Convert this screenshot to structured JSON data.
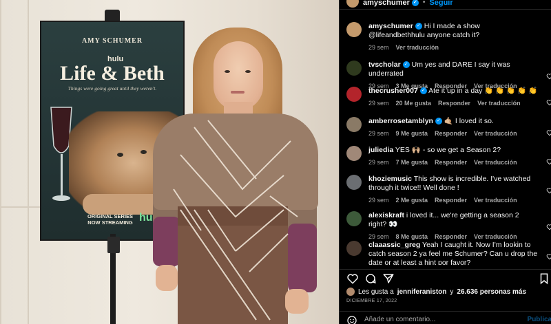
{
  "photo": {
    "poster": {
      "actor_name": "AMY SCHUMER",
      "network": "hulu",
      "title": "Life & Beth",
      "tagline": "Things were going great until they weren't.",
      "original_series": "ORIGINAL SERIES",
      "now_streaming": "NOW STREAMING",
      "brand": "hulu"
    }
  },
  "header": {
    "username": "amyschumer",
    "verified_mark": "✓",
    "separator": "•",
    "follow_label": "Seguir"
  },
  "comments": [
    {
      "user": "amyschumer",
      "verified": true,
      "text": "Hi I made a show @lifeandbethhulu anyone catch it?",
      "time": "29 sem",
      "likes": "",
      "reply": "",
      "translate": "Ver traducción",
      "avatar_color": "#c49a6c",
      "show_heart": false
    },
    {
      "user": "tvscholar",
      "verified": true,
      "text": "Um yes and DARE I say it was underrated",
      "time": "29 sem",
      "likes": "3 Me gusta",
      "reply": "Responder",
      "translate": "Ver traducción",
      "avatar_color": "#2f3a1e",
      "show_heart": true
    },
    {
      "user": "thecrusher007",
      "verified": true,
      "text": "Ate it up in a day 👏 👏 👏 👏 👏",
      "time": "29 sem",
      "likes": "20 Me gusta",
      "reply": "Responder",
      "translate": "Ver traducción",
      "avatar_color": "#b3242b",
      "show_heart": true
    },
    {
      "user": "amberrosetamblyn",
      "verified": true,
      "text": "🤙🏼 I loved it so.",
      "time": "29 sem",
      "likes": "9 Me gusta",
      "reply": "Responder",
      "translate": "Ver traducción",
      "avatar_color": "#8a7a66",
      "show_heart": true
    },
    {
      "user": "juliedia",
      "verified": false,
      "text": "YES 🙌🏼 - so we get a Season 2?",
      "time": "29 sem",
      "likes": "7 Me gusta",
      "reply": "Responder",
      "translate": "Ver traducción",
      "avatar_color": "#a08878",
      "show_heart": true
    },
    {
      "user": "khoziemusic",
      "verified": false,
      "text": "This show is incredible. I've watched through it twice!! Well done !",
      "time": "29 sem",
      "likes": "2 Me gusta",
      "reply": "Responder",
      "translate": "Ver traducción",
      "avatar_color": "#6b6e72",
      "show_heart": true
    },
    {
      "user": "alexiskraft",
      "verified": false,
      "text": "i loved it... we're getting a season 2 right? 👀",
      "time": "29 sem",
      "likes": "8 Me gusta",
      "reply": "Responder",
      "translate": "Ver traducción",
      "avatar_color": "#3d5a3a",
      "show_heart": true
    },
    {
      "user": "claaassic_greg",
      "verified": false,
      "text": "Yeah I caught it. Now I'm lookin to catch season 2 ya feel me Schumer? Can u drop the date or at least a hint por favor?",
      "time": "",
      "likes": "",
      "reply": "",
      "translate": "",
      "avatar_color": "#4a3a30",
      "show_heart": true
    }
  ],
  "actions": {
    "like": "heart-icon",
    "comment": "comment-icon",
    "share": "share-icon",
    "save": "bookmark-icon"
  },
  "likes": {
    "prefix": "Les gusta a",
    "user": "jenniferaniston",
    "connector": "y",
    "count": "26.636 personas más"
  },
  "date": "DICIEMBRE 17, 2022",
  "add_comment": {
    "placeholder": "Añade un comentario...",
    "publish_label": "Publicar"
  },
  "colors": {
    "accent": "#0095f6",
    "background": "#000000",
    "muted": "#a8a8a8"
  }
}
